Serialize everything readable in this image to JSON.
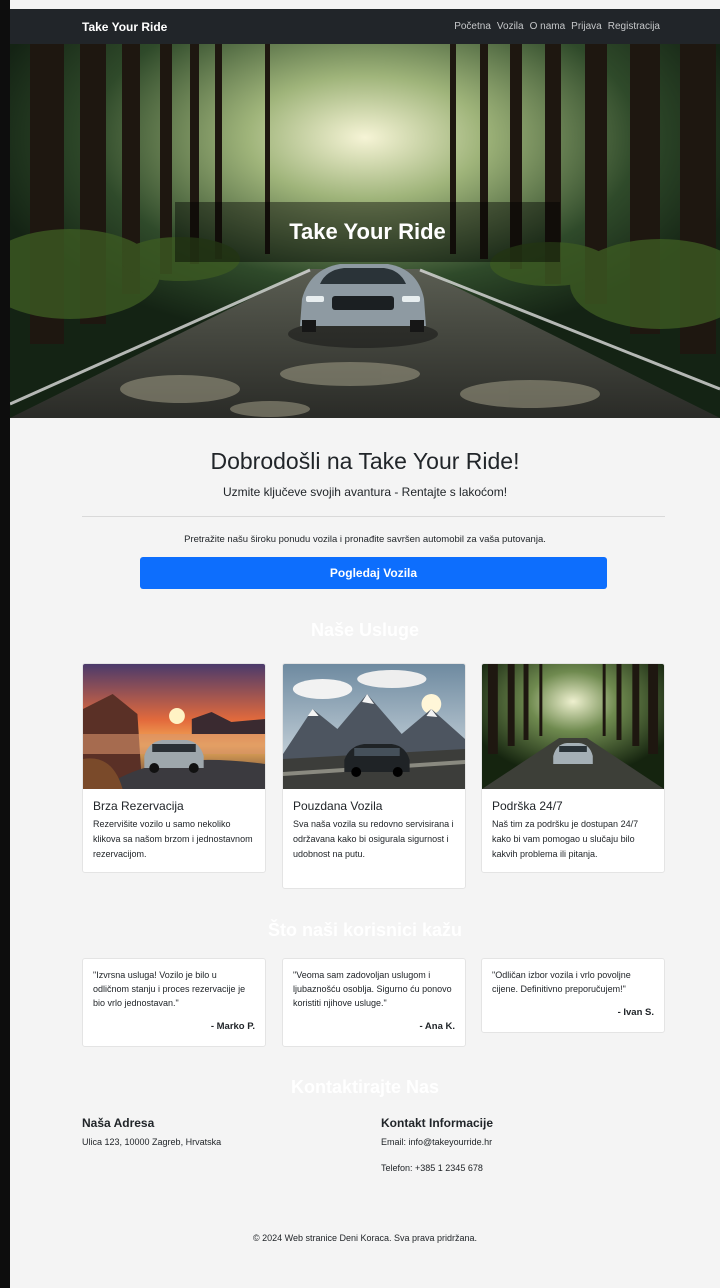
{
  "nav": {
    "brand": "Take Your Ride",
    "links": [
      "Početna",
      "Vozila",
      "O nama",
      "Prijava",
      "Registracija"
    ]
  },
  "hero": {
    "title": "Take Your Ride"
  },
  "welcome": {
    "heading": "Dobrodošli na Take Your Ride!",
    "lead": "Uzmite ključeve svojih avantura - Rentajte s lakoćom!",
    "search_text": "Pretražite našu široku ponudu vozila i pronađite savršen automobil za vaša putovanja.",
    "cta_label": "Pogledaj Vozila"
  },
  "services": {
    "title": "Naše Usluge",
    "cards": [
      {
        "title": "Brza Rezervacija",
        "text": "Rezervišite vozilo u samo nekoliko klikova sa našom brzom i jednostavnom rezervacijom."
      },
      {
        "title": "Pouzdana Vozila",
        "text": "Sva naša vozila su redovno servisirana i održavana kako bi osigurala sigurnost i udobnost na putu."
      },
      {
        "title": "Podrška 24/7",
        "text": "Naš tim za podršku je dostupan 24/7 kako bi vam pomogao u slučaju bilo kakvih problema ili pitanja."
      }
    ]
  },
  "testimonials": {
    "title": "Što naši korisnici kažu",
    "items": [
      {
        "quote": "\"Izvrsna usluga! Vozilo je bilo u odličnom stanju i proces rezervacije je bio vrlo jednostavan.\"",
        "author": "- Marko P."
      },
      {
        "quote": "\"Veoma sam zadovoljan uslugom i ljubaznošću osoblja. Sigurno ću ponovo koristiti njihove usluge.\"",
        "author": "- Ana K."
      },
      {
        "quote": "\"Odličan izbor vozila i vrlo povoljne cijene. Definitivno preporučujem!\"",
        "author": "- Ivan S."
      }
    ]
  },
  "contact": {
    "title": "Kontaktirajte Nas",
    "address_heading": "Naša Adresa",
    "address": "Ulica 123, 10000 Zagreb, Hrvatska",
    "info_heading": "Kontakt Informacije",
    "email": "Email: info@takeyourride.hr",
    "phone": "Telefon: +385 1 2345 678"
  },
  "footer": {
    "text": "© 2024 Web stranice Deni Koraca. Sva prava pridržana."
  }
}
